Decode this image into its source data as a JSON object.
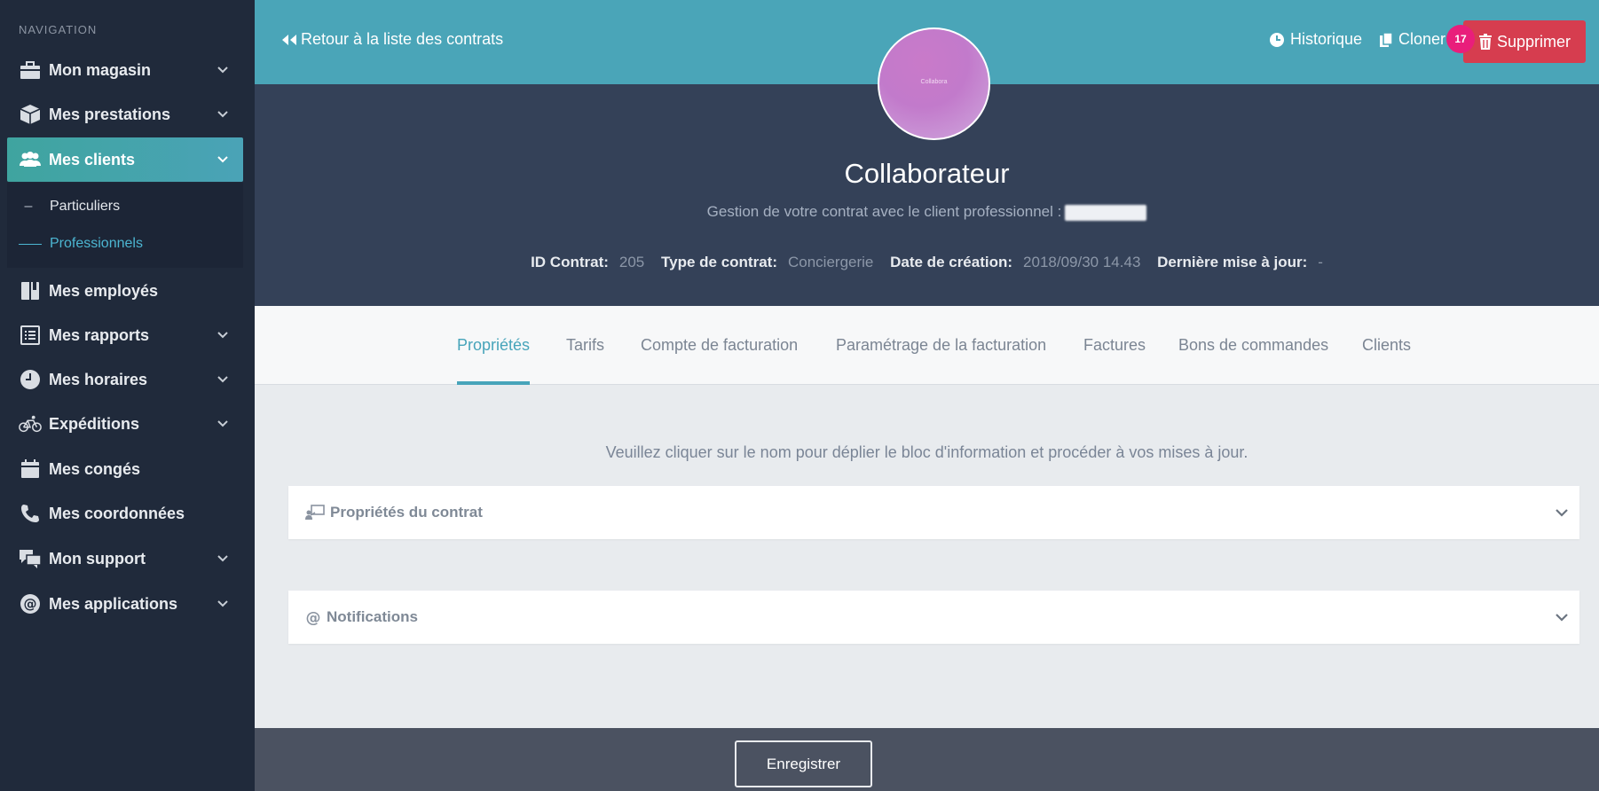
{
  "sidebar": {
    "title": "NAVIGATION",
    "items": [
      {
        "label": "Mon magasin",
        "icon": "briefcase-icon"
      },
      {
        "label": "Mes prestations",
        "icon": "cube-icon"
      },
      {
        "label": "Mes clients",
        "icon": "users-icon"
      },
      {
        "label": "Mes employés",
        "icon": "book-icon"
      },
      {
        "label": "Mes rapports",
        "icon": "list-icon"
      },
      {
        "label": "Mes horaires",
        "icon": "clock-icon"
      },
      {
        "label": "Expéditions",
        "icon": "bicycle-icon"
      },
      {
        "label": "Mes congés",
        "icon": "calendar-icon"
      },
      {
        "label": "Mes coordonnées",
        "icon": "phone-icon"
      },
      {
        "label": "Mon support",
        "icon": "chat-icon"
      },
      {
        "label": "Mes applications",
        "icon": "at-icon"
      }
    ],
    "subitems": [
      {
        "label": "Particuliers"
      },
      {
        "label": "Professionnels"
      }
    ]
  },
  "header": {
    "back_label": "Retour à la liste des contrats",
    "history_label": "Historique",
    "clone_label": "Cloner",
    "delete_label": "Supprimer",
    "badge_count": "17"
  },
  "hero": {
    "avatar_text": "Collabora",
    "title": "Collaborateur",
    "subtitle": "Gestion de votre contrat avec le client professionnel :",
    "meta": {
      "id_label": "ID Contrat:",
      "id_value": "205",
      "type_label": "Type de contrat:",
      "type_value": "Conciergerie",
      "created_label": "Date de création:",
      "created_value": "2018/09/30 14.43",
      "updated_label": "Dernière mise à jour:",
      "updated_value": "-"
    }
  },
  "tabs": [
    {
      "label": "Propriétés"
    },
    {
      "label": "Tarifs"
    },
    {
      "label": "Compte de facturation"
    },
    {
      "label": "Paramétrage de la facturation"
    },
    {
      "label": "Factures"
    },
    {
      "label": "Bons de commandes"
    },
    {
      "label": "Clients"
    }
  ],
  "main": {
    "hint": "Veuillez cliquer sur le nom pour déplier le bloc d'information et procéder à vos mises à jour.",
    "panels": [
      {
        "title": "Propriétés du contrat"
      },
      {
        "title": "Notifications"
      }
    ]
  },
  "footer": {
    "save_label": "Enregistrer"
  },
  "colors": {
    "accent": "#4aa5b8",
    "danger": "#d63d4f",
    "badge": "#e91e7b",
    "sidebar": "#202a3b",
    "hero": "#344158"
  }
}
